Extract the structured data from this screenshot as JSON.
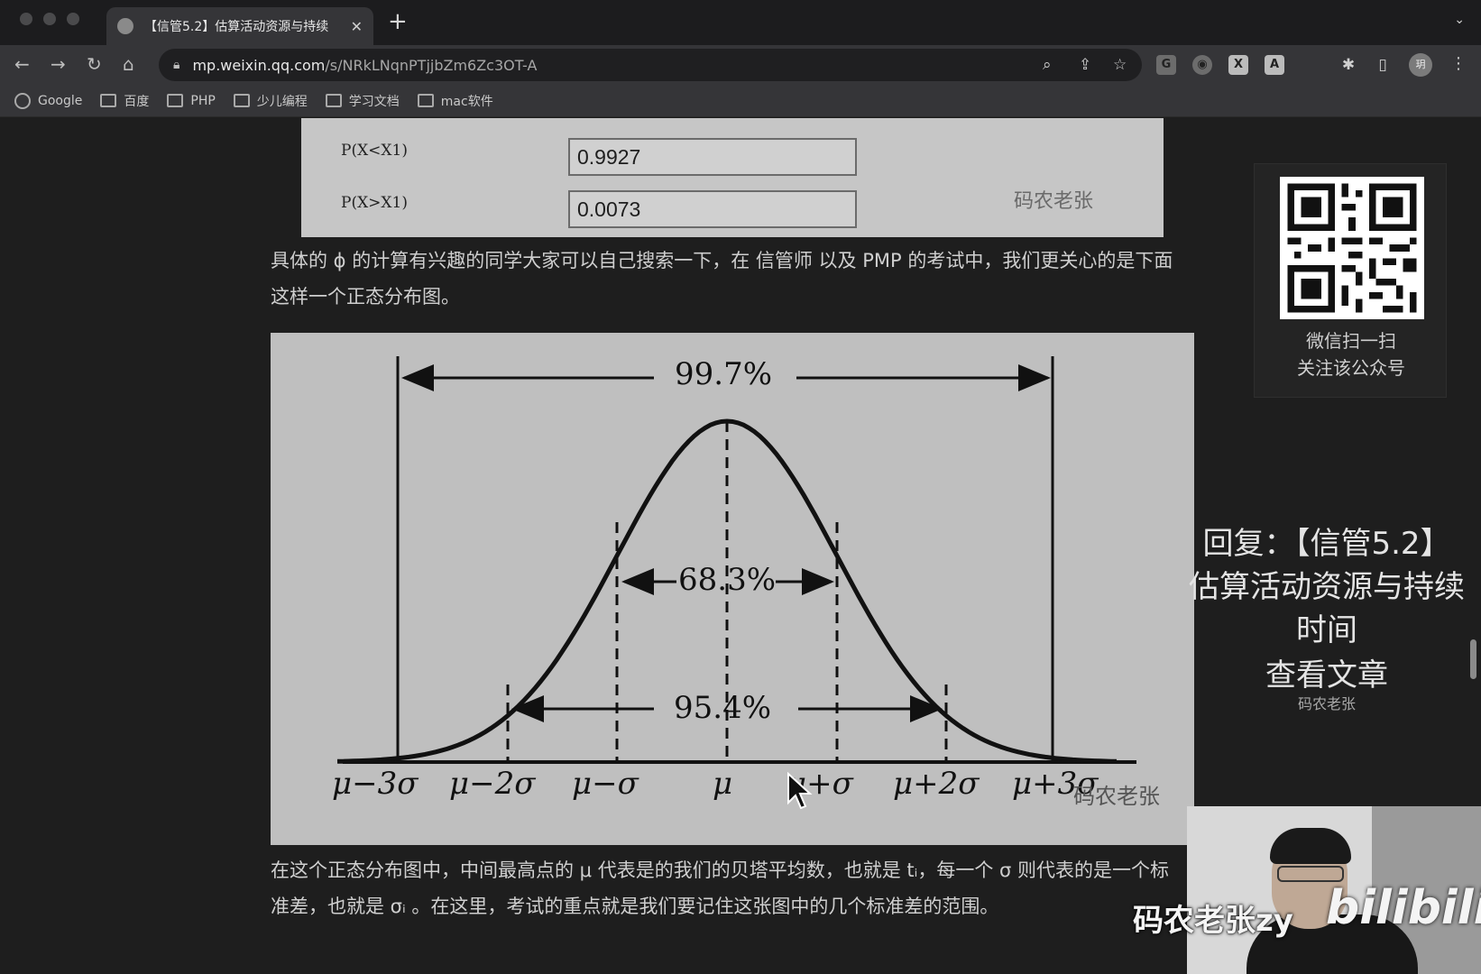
{
  "browser": {
    "tab_title": "【信管5.2】估算活动资源与持续",
    "url_host": "mp.weixin.qq.com",
    "url_path": "/s/NRkLNqnPTjjbZm6Zc3OT-A",
    "profile_initial": "玥",
    "bookmarks": [
      "Google",
      "百度",
      "PHP",
      "少儿编程",
      "学习文档",
      "mac软件"
    ]
  },
  "calculator": {
    "label_less": "P(X<X1)",
    "value_less": "0.9927",
    "label_greater": "P(X>X1)",
    "value_greater": "0.0073",
    "watermark": "码农老张"
  },
  "article": {
    "para1": "具体的 ϕ 的计算有兴趣的同学大家可以自己搜索一下，在 信管师 以及 PMP 的考试中，我们更关心的是下面这样一个正态分布图。",
    "para2": "在这个正态分布图中，中间最高点的 μ 代表是的我们的贝塔平均数，也就是 tᵢ，每一个 σ 则代表的是一个标准差，也就是 σᵢ 。在这里，考试的重点就是我们要记住这张图中的几个标准差的范围。"
  },
  "figure": {
    "pct_997": "99.7%",
    "pct_683": "68.3%",
    "pct_954": "95.4%",
    "tick_labels": [
      "μ−3σ",
      "μ−2σ",
      "μ−σ",
      "μ",
      "μ+σ",
      "μ+2σ",
      "μ+3σ"
    ],
    "watermark": "码农老张"
  },
  "sidebar": {
    "qr_caption_1": "微信扫一扫",
    "qr_caption_2": "关注该公众号"
  },
  "overlay": {
    "reply_1": "回复：【信管5.2】",
    "reply_2": "估算活动资源与持续",
    "reply_3": "时间",
    "reply_4": "查看文章",
    "reply_source": "码农老张",
    "uploader": "码农老张zy",
    "platform": "bilibili"
  }
}
